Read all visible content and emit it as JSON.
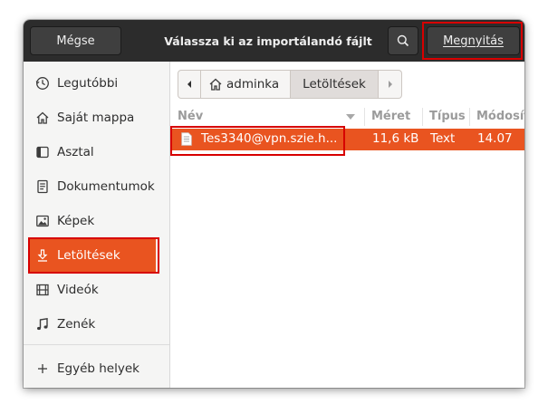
{
  "header": {
    "cancel_label": "Mégse",
    "title": "Válassza ki az importálandó fájlt",
    "open_label": "Megnyitás",
    "open_mnemonic": "M",
    "open_rest": "egnyitás"
  },
  "sidebar": {
    "items": [
      {
        "label": "Legutóbbi",
        "icon": "clock-icon"
      },
      {
        "label": "Saját mappa",
        "icon": "home-icon"
      },
      {
        "label": "Asztal",
        "icon": "desktop-icon"
      },
      {
        "label": "Dokumentumok",
        "icon": "document-icon"
      },
      {
        "label": "Képek",
        "icon": "image-icon"
      },
      {
        "label": "Letöltések",
        "icon": "download-icon",
        "active": true
      },
      {
        "label": "Videók",
        "icon": "film-icon"
      },
      {
        "label": "Zenék",
        "icon": "music-icon"
      }
    ],
    "other": {
      "label": "Egyéb helyek",
      "icon": "plus-icon"
    }
  },
  "pathbar": {
    "segments": [
      "adminka",
      "Letöltések"
    ]
  },
  "columns": {
    "name": "Név",
    "size": "Méret",
    "type": "Típus",
    "modified": "Módosítva"
  },
  "files": [
    {
      "name": "Tes3340@vpn.szie.h...",
      "size": "11,6 kB",
      "type": "Text",
      "modified": "14.07"
    }
  ],
  "colors": {
    "accent": "#e95420",
    "headerbar": "#2c2c2c",
    "highlight": "#d70000"
  }
}
